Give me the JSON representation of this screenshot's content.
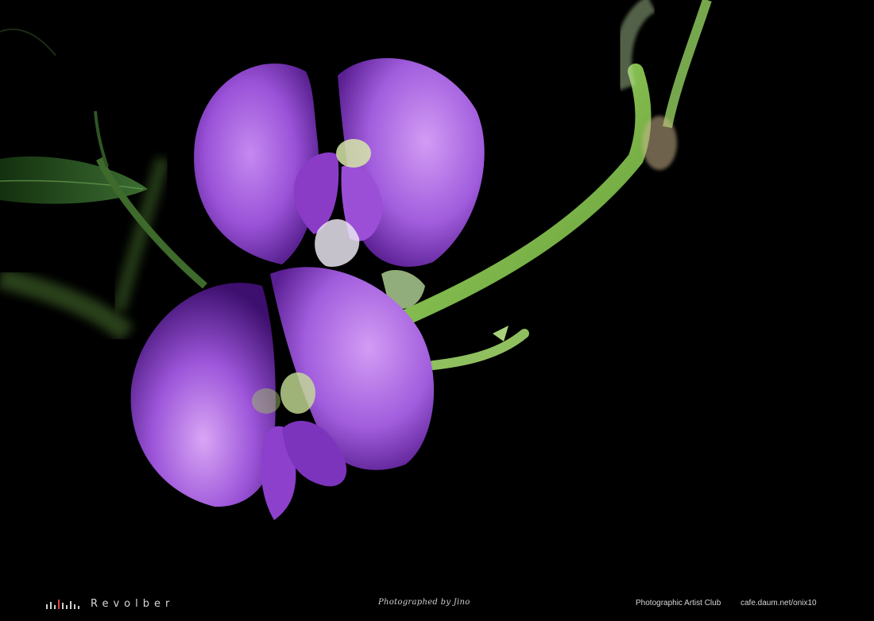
{
  "footer": {
    "brand": "Revolber",
    "credit": "Photographed by Jino",
    "club": "Photographic Artist Club",
    "site": "cafe.daum.net/onix10"
  },
  "colors": {
    "background": "#000000",
    "petal": "#9b4fd6",
    "petal_light": "#c58af0",
    "stem": "#7fc24a",
    "leaf": "#2f5a2a"
  },
  "icons": {
    "logo": "bar-graph-logo-icon"
  }
}
